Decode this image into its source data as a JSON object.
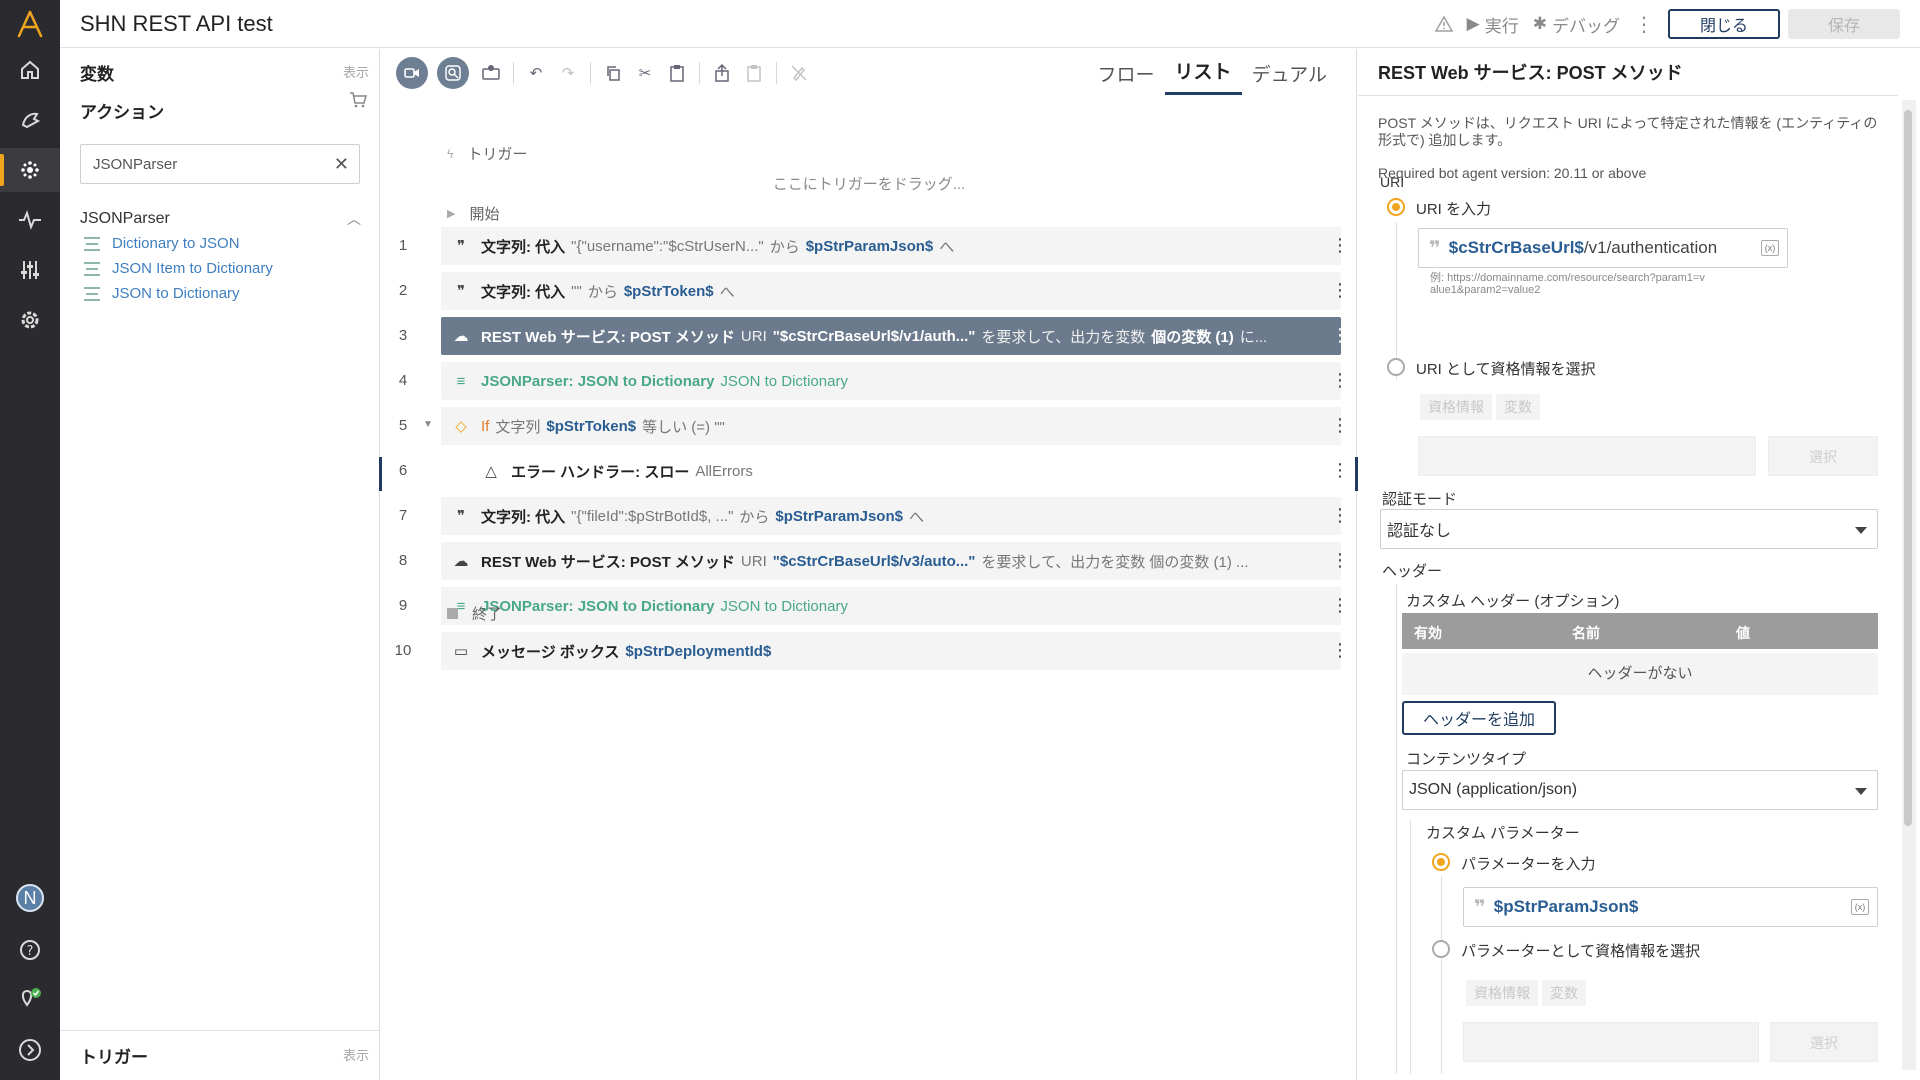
{
  "app": {
    "title": "SHN REST API test",
    "toolbar": {
      "run_label": "実行",
      "debug_label": "デバッグ",
      "close_label": "閉じる",
      "save_label": "保存"
    }
  },
  "left_panel": {
    "variables_title": "変数",
    "variables_hint": "表示",
    "actions_title": "アクション",
    "search_value": "JSONParser",
    "group_title": "JSONParser",
    "actions": [
      {
        "label": "Dictionary to JSON"
      },
      {
        "label": "JSON Item to Dictionary"
      },
      {
        "label": "JSON to Dictionary"
      }
    ],
    "triggers_title": "トリガー",
    "triggers_hint": "表示"
  },
  "center": {
    "views": [
      {
        "label": "フロー",
        "active": false
      },
      {
        "label": "リスト",
        "active": true
      },
      {
        "label": "デュアル",
        "active": false
      }
    ],
    "trigger_label": "トリガー",
    "drag_hint": "ここにトリガーをドラッグ...",
    "start_label": "開始",
    "end_label": "終了",
    "rows": [
      {
        "num": "1",
        "parts": [
          [
            "kw",
            "文字列: 代入"
          ],
          [
            "dim",
            "\"{\"username\":\"$cStrUserN...\""
          ],
          [
            "dim",
            "から"
          ],
          [
            "var",
            "$pStrParamJson$"
          ],
          [
            "dim",
            "へ"
          ]
        ]
      },
      {
        "num": "2",
        "parts": [
          [
            "kw",
            "文字列: 代入"
          ],
          [
            "dim",
            "\"\""
          ],
          [
            "dim",
            "から"
          ],
          [
            "var",
            "$pStrToken$"
          ],
          [
            "dim",
            "へ"
          ]
        ]
      },
      {
        "num": "3",
        "parts": [
          [
            "kw",
            "REST Web サービス: POST メソッド"
          ],
          [
            "dim",
            "URI"
          ],
          [
            "kw",
            "\"$cStrCrBaseUrl$/v1/auth...\""
          ],
          [
            "dim",
            "を要求して、出力を変数"
          ],
          [
            "kw",
            "個の変数 (1)"
          ],
          [
            "dim",
            "に..."
          ]
        ]
      },
      {
        "num": "4",
        "parts": [
          [
            "greenb",
            "JSONParser: JSON to Dictionary"
          ],
          [
            "green",
            "JSON to Dictionary"
          ]
        ]
      },
      {
        "num": "5",
        "parts": [
          [
            "if",
            "If"
          ],
          [
            "dim",
            "文字列"
          ],
          [
            "var",
            "$pStrToken$"
          ],
          [
            "dim",
            "等しい (=) \"\""
          ]
        ]
      },
      {
        "num": "6",
        "parts": [
          [
            "kw",
            "エラー ハンドラー: スロー"
          ],
          [
            "dim",
            "AllErrors"
          ]
        ]
      },
      {
        "num": "7",
        "parts": [
          [
            "kw",
            "文字列: 代入"
          ],
          [
            "dim",
            "\"{\"fileId\":$pStrBotId$, ...\""
          ],
          [
            "dim",
            "から"
          ],
          [
            "var",
            "$pStrParamJson$"
          ],
          [
            "dim",
            "へ"
          ]
        ]
      },
      {
        "num": "8",
        "parts": [
          [
            "kw",
            "REST Web サービス: POST メソッド"
          ],
          [
            "dim",
            "URI"
          ],
          [
            "var",
            "\"$cStrCrBaseUrl$/v3/auto...\""
          ],
          [
            "dim",
            "を要求して、出力を変数 個の変数 (1) ..."
          ]
        ]
      },
      {
        "num": "9",
        "parts": [
          [
            "greenb",
            "JSONParser: JSON to Dictionary"
          ],
          [
            "green",
            "JSON to Dictionary"
          ]
        ]
      },
      {
        "num": "10",
        "parts": [
          [
            "kw",
            "メッセージ ボックス"
          ],
          [
            "var",
            "$pStrDeploymentId$"
          ]
        ]
      }
    ]
  },
  "right_panel": {
    "title": "REST Web サービス: POST メソッド",
    "description": "POST メソッドは、リクエスト URI によって特定された情報を (エンティティの形式で) 追加します。",
    "version": "Required bot agent version: 20.11 or above",
    "uri_label": "URI",
    "uri_option_enter": "URI を入力",
    "uri_var": "$cStrCrBaseUrl$",
    "uri_path": "/v1/authentication",
    "uri_example": "例: https://domainname.com/resource/search?param1=value1&param2=value2",
    "uri_option_credential": "URI として資格情報を選択",
    "credential_tab": "資格情報",
    "variable_tab": "変数",
    "select_label": "選択",
    "auth_mode_label": "認証モード",
    "auth_mode_value": "認証なし",
    "header_label": "ヘッダー",
    "custom_header_label": "カスタム ヘッダー (オプション)",
    "header_columns": [
      "有効",
      "名前",
      "値"
    ],
    "no_headers": "ヘッダーがない",
    "add_header_label": "ヘッダーを追加",
    "content_type_label": "コンテンツタイプ",
    "content_type_value": "JSON (application/json)",
    "custom_param_label": "カスタム パラメーター",
    "param_option_enter": "パラメーターを入力",
    "param_var": "$pStrParamJson$",
    "param_option_credential": "パラメーターとして資格情報を選択"
  },
  "colors": {
    "accent": "#f0a51e",
    "navy": "#1e3a5f",
    "selected_row": "#6b7a8c",
    "variable": "#2a5d92",
    "package": "#48a887"
  }
}
